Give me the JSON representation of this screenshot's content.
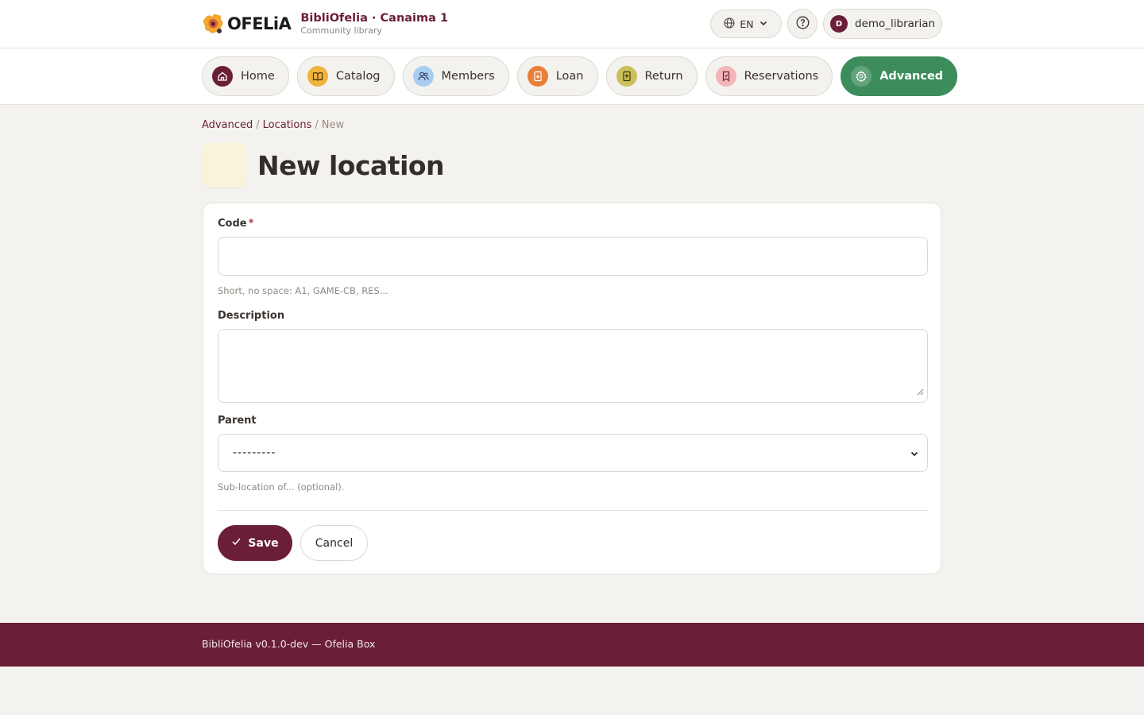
{
  "header": {
    "logo_word": "OFELiA",
    "brand_title": "BibliOfelia · Canaima 1",
    "brand_subtitle": "Community library",
    "lang": "EN",
    "user_initial": "D",
    "username": "demo_librarian"
  },
  "nav": {
    "items": [
      {
        "label": "Home",
        "icon": "home-icon",
        "color": "#6b1f37"
      },
      {
        "label": "Catalog",
        "icon": "book-icon",
        "color": "#f0b43c"
      },
      {
        "label": "Members",
        "icon": "users-icon",
        "color": "#a9cdf2"
      },
      {
        "label": "Loan",
        "icon": "loan-icon",
        "color": "#e8803a"
      },
      {
        "label": "Return",
        "icon": "return-icon",
        "color": "#cbbf57"
      },
      {
        "label": "Reservations",
        "icon": "bookmark-icon",
        "color": "#f4b5b8"
      },
      {
        "label": "Advanced",
        "icon": "gear-icon",
        "color": "#3c8c5c",
        "active": true
      }
    ]
  },
  "breadcrumb": {
    "items": [
      "Advanced",
      "Locations"
    ],
    "current": "New"
  },
  "page": {
    "title": "New location"
  },
  "form": {
    "code_label": "Code",
    "code_required": "*",
    "code_value": "",
    "code_help": "Short, no space: A1, GAME-CB, RES...",
    "description_label": "Description",
    "description_value": "",
    "parent_label": "Parent",
    "parent_selected": "---------",
    "parent_help": "Sub-location of... (optional).",
    "save_label": "Save",
    "cancel_label": "Cancel"
  },
  "footer": {
    "text": "BibliOfelia v0.1.0-dev — Ofelia Box"
  }
}
